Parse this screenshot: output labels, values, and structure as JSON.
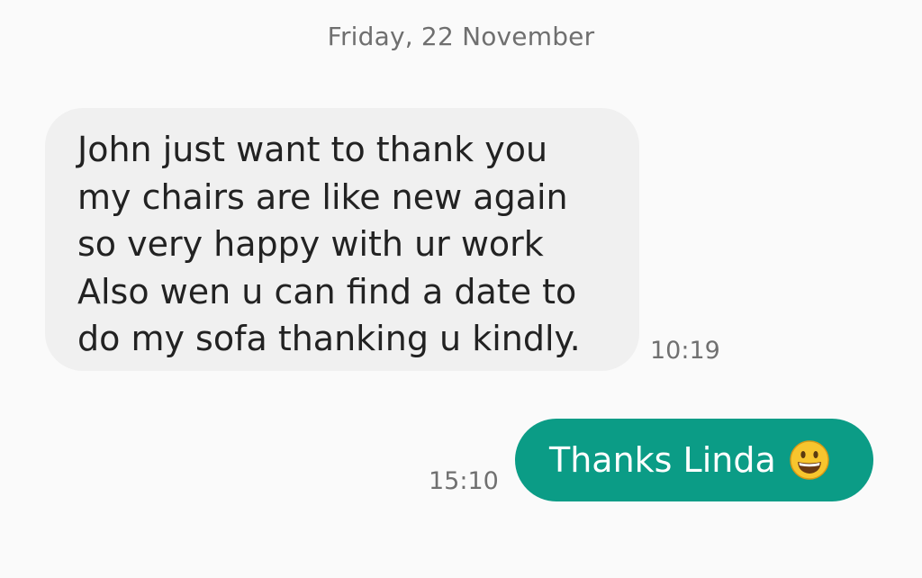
{
  "conversation": {
    "date_header": "Friday, 22 November",
    "messages": [
      {
        "direction": "incoming",
        "lines": [
          "John just want to thank you",
          "my chairs are like new again",
          "so very happy with ur work",
          "Also wen u can find a date to",
          "do my sofa thanking u kindly."
        ],
        "time": "10:19"
      },
      {
        "direction": "outgoing",
        "text": "Thanks Linda",
        "emoji": "grinning-face-icon",
        "time": "15:10"
      }
    ]
  },
  "colors": {
    "background": "#fafafa",
    "incoming_bubble": "#f0f0f0",
    "outgoing_bubble": "#0b9c86",
    "timestamp": "#707070"
  }
}
